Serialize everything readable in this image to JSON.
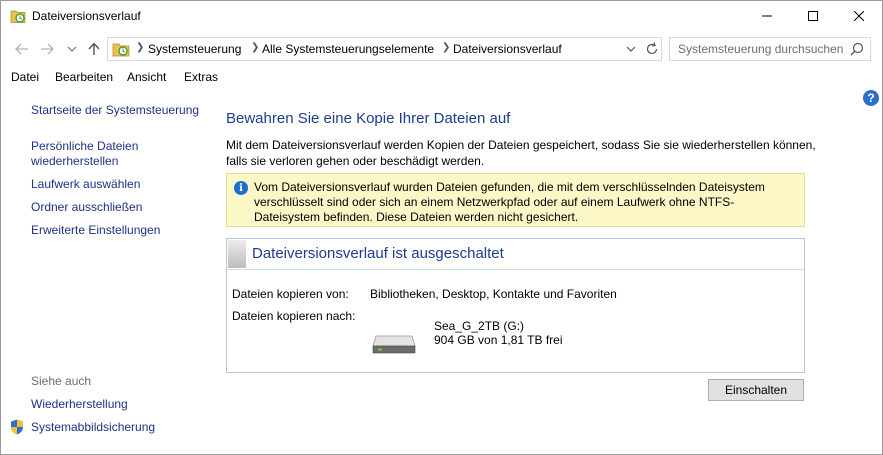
{
  "window": {
    "title": "Dateiversionsverlauf"
  },
  "address": {
    "crumbs": [
      "Systemsteuerung",
      "Alle Systemsteuerungselemente",
      "Dateiversionsverlauf"
    ]
  },
  "search": {
    "placeholder": "Systemsteuerung durchsuchen"
  },
  "menu": [
    "Datei",
    "Bearbeiten",
    "Ansicht",
    "Extras"
  ],
  "sidebar": {
    "links": [
      "Startseite der Systemsteuerung",
      "Persönliche Dateien",
      "wiederherstellen",
      "Laufwerk auswählen",
      "Ordner ausschließen",
      "Erweiterte Einstellungen"
    ],
    "see_also_label": "Siehe auch",
    "see_also": [
      "Wiederherstellung",
      "Systemabbildsicherung"
    ]
  },
  "main": {
    "title": "Bewahren Sie eine Kopie Ihrer Dateien auf",
    "description": "Mit dem Dateiversionsverlauf werden Kopien der Dateien gespeichert, sodass Sie sie wiederherstellen können, falls sie verloren gehen oder beschädigt werden.",
    "info": "Vom Dateiversionsverlauf wurden Dateien gefunden, die mit dem verschlüsselnden Dateisystem verschlüsselt sind oder sich an einem Netzwerkpfad oder auf einem Laufwerk ohne NTFS-Dateisystem befinden. Diese Dateien werden nicht gesichert.",
    "status": {
      "title": "Dateiversionsverlauf ist ausgeschaltet",
      "copy_from_label": "Dateien kopieren von:",
      "copy_from_value": "Bibliotheken, Desktop, Kontakte und Favoriten",
      "copy_to_label": "Dateien kopieren nach:",
      "drive_name": "Sea_G_2TB (G:)",
      "drive_space": "904 GB von 1,81 TB frei"
    },
    "enable_button": "Einschalten"
  },
  "colors": {
    "link": "#1e3287",
    "heading": "#1e3b8f",
    "info_bg": "#fbf7c6",
    "info_icon": "#1d6fce"
  },
  "icons": [
    "file-history-icon",
    "back-icon",
    "forward-icon",
    "recent-icon",
    "up-icon",
    "folder-icon",
    "dropdown-icon",
    "refresh-icon",
    "search-icon",
    "help-icon",
    "info-icon",
    "drive-icon",
    "shield-icon"
  ]
}
